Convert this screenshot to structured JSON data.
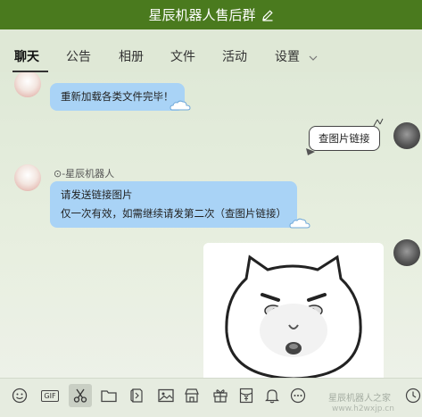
{
  "window": {
    "title": "星辰机器人售后群"
  },
  "tabs": [
    {
      "label": "聊天",
      "active": true
    },
    {
      "label": "公告"
    },
    {
      "label": "相册"
    },
    {
      "label": "文件"
    },
    {
      "label": "活动"
    },
    {
      "label": "设置"
    }
  ],
  "messages": [
    {
      "sender": "",
      "text": "重新加载各类文件完毕！"
    },
    {
      "text": "查图片链接"
    },
    {
      "sender": "⊙-星辰机器人",
      "lines": [
        "请发送链接图片",
        "仅一次有效，如需继续请发第二次（查图片链接）"
      ]
    }
  ],
  "toolbar": {
    "gif_label": "GIF",
    "items": [
      "emoji-icon",
      "gif-icon",
      "scissors-icon",
      "folder-icon",
      "shake-icon",
      "image-icon",
      "store-icon",
      "gift-icon",
      "red-packet-icon",
      "bell-icon",
      "more-icon",
      "history-icon"
    ]
  },
  "watermark": {
    "line1": "星辰机器人之家",
    "line2": "www.h2wxjp.cn"
  },
  "colors": {
    "titlebar": "#4a7a1e",
    "bubble": "#a9d3f6",
    "background": "#dfe8d6"
  }
}
